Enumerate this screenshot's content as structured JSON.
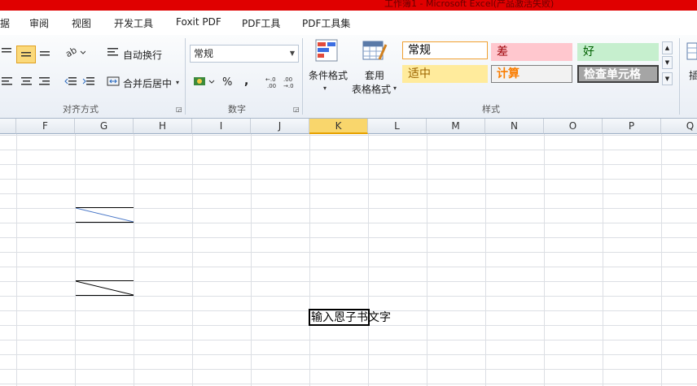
{
  "window": {
    "title": "工作簿1 - Microsoft Excel(产品激活失败)"
  },
  "menu": {
    "tabs": [
      "据",
      "审阅",
      "视图",
      "开发工具",
      "Foxit PDF",
      "PDF工具",
      "PDF工具集"
    ]
  },
  "ribbon": {
    "alignment": {
      "wrap_text": "自动换行",
      "merge_center": "合并后居中",
      "group_label": "对齐方式"
    },
    "number": {
      "format_value": "常规",
      "percent": "%",
      "comma": ",",
      "group_label": "数字"
    },
    "styles": {
      "conditional_format": "条件格式",
      "table_format_line1": "套用",
      "table_format_line2": "表格格式",
      "group_label": "样式",
      "cells": [
        {
          "label": "常规",
          "bg": "#ffffff",
          "fg": "#000000",
          "border": "#f0a030"
        },
        {
          "label": "差",
          "bg": "#ffc7ce",
          "fg": "#9c0006",
          "border": "#ffc7ce"
        },
        {
          "label": "好",
          "bg": "#c6efce",
          "fg": "#006100",
          "border": "#c6efce"
        },
        {
          "label": "适中",
          "bg": "#ffeb9c",
          "fg": "#9c6500",
          "border": "#ffeb9c"
        },
        {
          "label": "计算",
          "bg": "#f2f2f2",
          "fg": "#fa7d00",
          "border": "#7f7f7f"
        },
        {
          "label": "检查单元格",
          "bg": "#a5a5a5",
          "fg": "#ffffff",
          "border": "#3f3f3f"
        }
      ],
      "more": "插"
    }
  },
  "columns": [
    "F",
    "G",
    "H",
    "I",
    "J",
    "K",
    "L",
    "M",
    "N",
    "O",
    "P",
    "Q"
  ],
  "selected_column": "K",
  "active_cell": {
    "text": "输入恩子书文字"
  },
  "colors": {
    "title_bar": "#e00000",
    "selected_header": "#f9d66c"
  }
}
